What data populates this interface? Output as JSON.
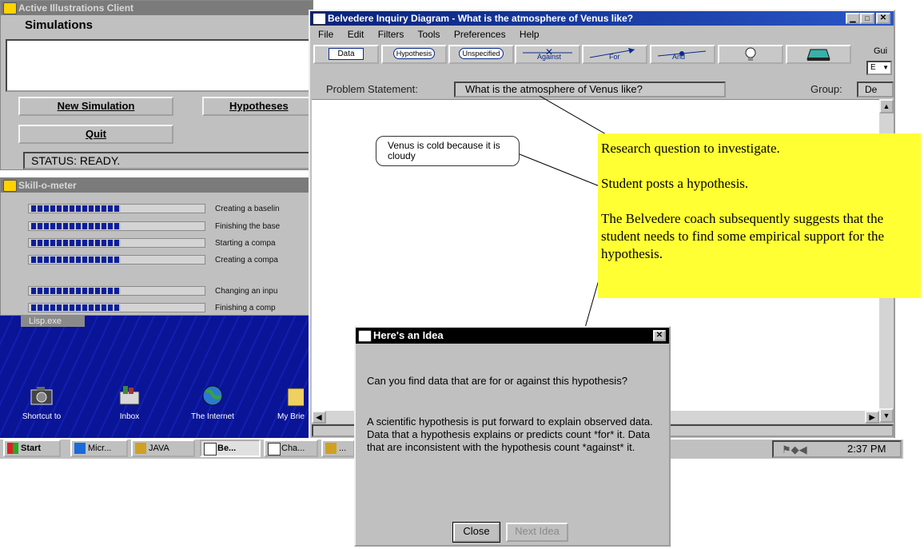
{
  "ai_client": {
    "title": "Active Illustrations Client",
    "section_label": "Simulations",
    "new_simulation_label": "New Simulation",
    "hypotheses_label": "Hypotheses",
    "quit_label": "Quit",
    "status_text": "STATUS: READY."
  },
  "skill_meter": {
    "title": "Skill-o-meter",
    "items": [
      {
        "label": "Creating a baselin"
      },
      {
        "label": "Finishing the base"
      },
      {
        "label": "Starting a compa"
      },
      {
        "label": "Creating a compa"
      },
      {
        "label": "Changing an inpu"
      },
      {
        "label": "Finishing a comp"
      }
    ]
  },
  "lisp": {
    "title": "Lisp.exe"
  },
  "desktop_icons": [
    {
      "label": "Shortcut to"
    },
    {
      "label": "Inbox"
    },
    {
      "label": "The Internet"
    },
    {
      "label": "My Brie"
    }
  ],
  "belvedere": {
    "title": "Belvedere Inquiry Diagram - What is the atmosphere of Venus like?",
    "menu": [
      "File",
      "Edit",
      "Filters",
      "Tools",
      "Preferences",
      "Help"
    ],
    "toolbar": {
      "data": "Data",
      "hypothesis": "Hypothesis",
      "unspecified": "Unspecified",
      "against": "Against",
      "for": "For",
      "and": "And"
    },
    "guide_label": "Gui",
    "guide_select": "E",
    "problem_label": "Problem Statement:",
    "problem_text": "What is the atmosphere of Venus like?",
    "group_label": "Group:",
    "group_value": "De",
    "hypothesis_node": "Venus is cold because it is cloudy"
  },
  "annotation": {
    "line1": "Research question to investigate.",
    "line2": "Student posts a hypothesis.",
    "line3": "The Belvedere coach subsequently suggests that the student needs to find some empirical support for the hypothesis."
  },
  "idea_dialog": {
    "title": "Here's an Idea",
    "question": "Can you find data that are for or against this hypothesis?",
    "body": "A scientific hypothesis is put forward to explain observed data. Data that a hypothesis explains or predicts count *for* it. Data that are inconsistent with the hypothesis count *against* it.",
    "close_label": "Close",
    "next_label": "Next Idea"
  },
  "taskbar": {
    "start_label": "Start",
    "items": [
      "Micr...",
      "JAVA",
      "Be...",
      "Cha...",
      "..."
    ],
    "clock": "2:37 PM"
  },
  "colors": {
    "accent_titlebar": "#0b2a8a",
    "desktop": "#0a1496",
    "annotation_bg": "#ffff33",
    "window_gray": "#c0c0c0"
  }
}
